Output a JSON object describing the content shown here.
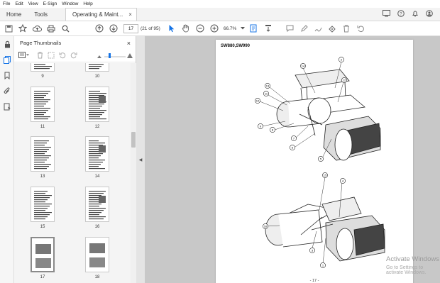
{
  "menu": [
    "File",
    "Edit",
    "View",
    "E-Sign",
    "Window",
    "Help"
  ],
  "tabs": {
    "home": "Home",
    "tools": "Tools",
    "document": "Operating & Maint...",
    "close": "×"
  },
  "toolbar": {
    "page_current": "17",
    "page_count": "(21 of 95)",
    "zoom": "66.7%"
  },
  "panel": {
    "title": "Page Thumbnails",
    "close": "×"
  },
  "thumbnails": [
    "9",
    "10",
    "11",
    "12",
    "13",
    "14",
    "15",
    "16",
    "17",
    "18"
  ],
  "selected_page": "17",
  "document": {
    "heading": "SW880,SW990",
    "page_number": "- 17 -",
    "callouts_top": [
      "14",
      "2",
      "13",
      "12",
      "11",
      "10",
      "9",
      "8",
      "7",
      "6",
      "5"
    ],
    "callouts_bottom": [
      "15",
      "4",
      "16",
      "3",
      "1"
    ]
  },
  "watermark": {
    "line1": "Activate Windows",
    "line2": "Go to Settings to activate Windows."
  },
  "colors": {
    "accent": "#1473e6",
    "workspace": "#c8c8c8",
    "selected_border": "#8a8a8a"
  }
}
